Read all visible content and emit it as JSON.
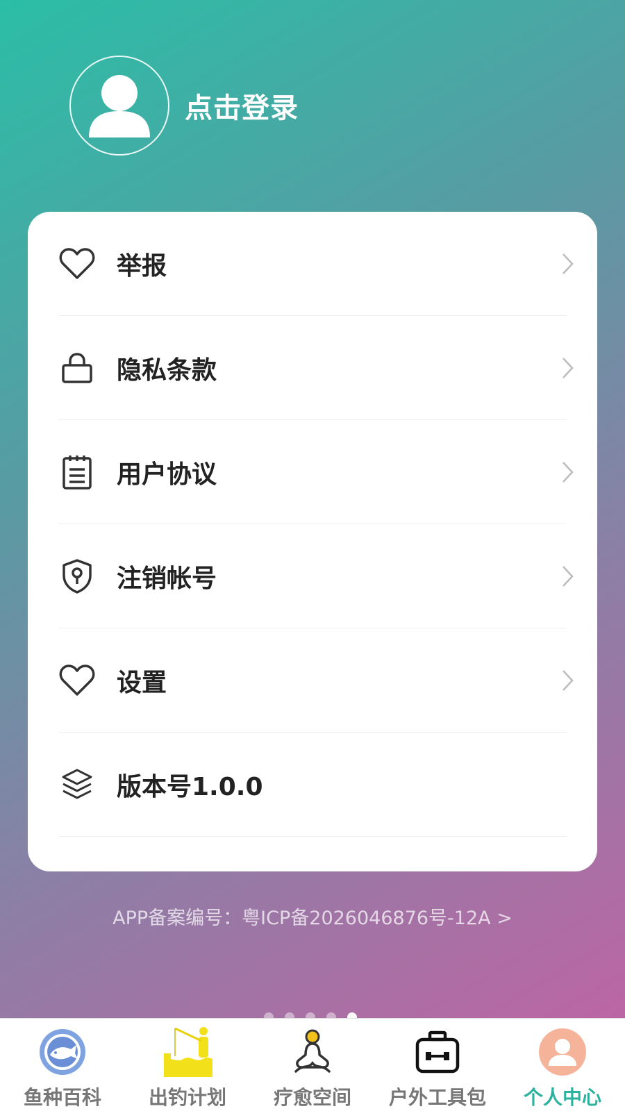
{
  "profile": {
    "login_label": "点击登录",
    "avatar_icon": "user-avatar-icon"
  },
  "menu": [
    {
      "label": "举报",
      "icon": "heart-icon",
      "has_chevron": true
    },
    {
      "label": "隐私条款",
      "icon": "lock-icon",
      "has_chevron": true
    },
    {
      "label": "用户协议",
      "icon": "notepad-icon",
      "has_chevron": true
    },
    {
      "label": "注销帐号",
      "icon": "shield-key-icon",
      "has_chevron": true
    },
    {
      "label": "设置",
      "icon": "heart-icon",
      "has_chevron": true
    },
    {
      "label": "版本号1.0.0",
      "icon": "layers-icon",
      "has_chevron": false
    }
  ],
  "icp_text": "APP备案编号：粤ICP备2026046876号-12A >",
  "pager": {
    "count": 5,
    "active_index": 4
  },
  "tabs": [
    {
      "label": "鱼种百科",
      "icon": "fish-globe-icon",
      "active": false
    },
    {
      "label": "出钓计划",
      "icon": "fishing-person-icon",
      "active": false
    },
    {
      "label": "疗愈空间",
      "icon": "meditation-icon",
      "active": false
    },
    {
      "label": "户外工具包",
      "icon": "toolbox-icon",
      "active": false
    },
    {
      "label": "个人中心",
      "icon": "user-circle-icon",
      "active": true
    }
  ],
  "colors": {
    "accent": "#2cb3a0",
    "gradient_start": "#2bbea6",
    "gradient_end": "#c561a3"
  }
}
